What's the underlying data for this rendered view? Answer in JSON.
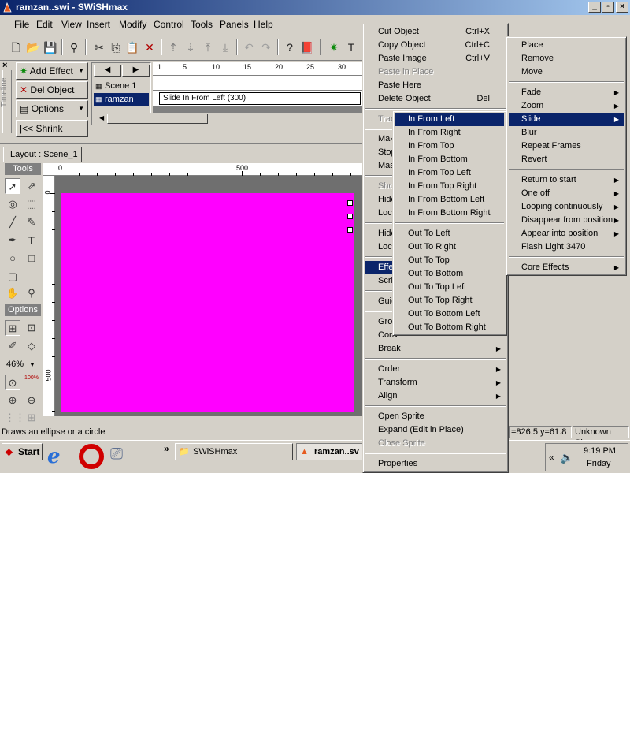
{
  "window": {
    "title": "ramzan..swi - SWiSHmax"
  },
  "menubar": [
    "File",
    "Edit",
    "View",
    "Insert",
    "Modify",
    "Control",
    "Tools",
    "Panels",
    "Help"
  ],
  "timeline": {
    "tab_label": "Timeline",
    "buttons": {
      "add_effect": "Add Effect",
      "del_object": "Del Object",
      "options": "Options",
      "shrink": "Shrink"
    },
    "scenes": [
      {
        "label": "Scene 1"
      },
      {
        "label": "ramzan"
      }
    ],
    "ruler_numbers": [
      "1",
      "5",
      "10",
      "15",
      "20",
      "25",
      "30"
    ],
    "effect_label": "Slide In From Left (300)"
  },
  "layout": {
    "tab_label": "Layout : Scene_1",
    "ruler_top": [
      "0",
      "500"
    ],
    "ruler_left": [
      "0",
      "500"
    ]
  },
  "tools_panel": {
    "header": "Tools",
    "options_header": "Options",
    "zoom": "46%",
    "zoom_100": "100%"
  },
  "status": {
    "hint": "Draws an ellipse or a circle",
    "coords": "=826.5 y=61.8",
    "size": "Unknown Size"
  },
  "taskbar": {
    "start": "Start",
    "tasks": [
      "SWiSHmax",
      "ramzan..sv"
    ],
    "time": "9:19 PM",
    "day": "Friday",
    "chevron": "»"
  },
  "context_menu": {
    "items": [
      {
        "label": "Cut Object",
        "shortcut": "Ctrl+X",
        "disabled": false
      },
      {
        "label": "Copy Object",
        "shortcut": "Ctrl+C",
        "disabled": false
      },
      {
        "label": "Paste Image",
        "shortcut": "Ctrl+V",
        "disabled": false
      },
      {
        "label": "Paste in Place",
        "shortcut": "",
        "disabled": true
      },
      {
        "label": "Paste Here",
        "shortcut": "",
        "disabled": false
      },
      {
        "label": "Delete Object",
        "shortcut": "Del",
        "disabled": false
      }
    ],
    "partial": [
      "Trac",
      "Mak",
      "Stop",
      "Mas",
      "Sho",
      "Hide",
      "Lock",
      "Hide",
      "Lock",
      "Effe",
      "Scri",
      "Guid",
      "Gro",
      "Conv"
    ],
    "lower": [
      {
        "label": "Break",
        "submenu": true
      },
      {
        "label": "Order",
        "submenu": true
      },
      {
        "label": "Transform",
        "submenu": true
      },
      {
        "label": "Align",
        "submenu": true
      },
      {
        "label": "Open Sprite",
        "submenu": false,
        "disabled": false
      },
      {
        "label": "Expand (Edit in Place)",
        "submenu": false,
        "disabled": false
      },
      {
        "label": "Close Sprite",
        "submenu": false,
        "disabled": true
      },
      {
        "label": "Properties",
        "submenu": false,
        "disabled": false
      }
    ]
  },
  "slide_submenu": {
    "in": [
      "In From Left",
      "In From Right",
      "In From Top",
      "In From Bottom",
      "In From Top Left",
      "In From Top Right",
      "In From Bottom Left",
      "In From Bottom Right"
    ],
    "out": [
      "Out To Left",
      "Out To Right",
      "Out To Top",
      "Out To Bottom",
      "Out To Top Left",
      "Out To Top Right",
      "Out To Bottom Left",
      "Out To Bottom Right"
    ],
    "selected": "In From Left"
  },
  "effect_submenu": {
    "group1": [
      "Place",
      "Remove",
      "Move"
    ],
    "group2": [
      {
        "label": "Fade",
        "submenu": true
      },
      {
        "label": "Zoom",
        "submenu": true
      },
      {
        "label": "Slide",
        "submenu": true
      },
      {
        "label": "Blur",
        "submenu": false
      },
      {
        "label": "Repeat Frames",
        "submenu": false
      },
      {
        "label": "Revert",
        "submenu": false
      }
    ],
    "group3": [
      {
        "label": "Return to start",
        "submenu": true
      },
      {
        "label": "One off",
        "submenu": true
      },
      {
        "label": "Looping continuously",
        "submenu": true
      },
      {
        "label": "Disappear from position",
        "submenu": true
      },
      {
        "label": "Appear into position",
        "submenu": true
      },
      {
        "label": "Flash Light 3470",
        "submenu": false
      }
    ],
    "group4": [
      {
        "label": "Core Effects",
        "submenu": true
      }
    ],
    "selected": "Slide"
  }
}
